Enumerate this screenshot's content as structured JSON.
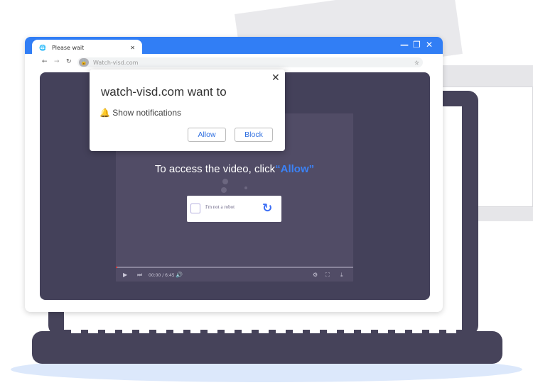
{
  "browser": {
    "tab_title": "Please wait",
    "url": "Watch-visd.com",
    "accent": "#317ef5"
  },
  "popup": {
    "title": "watch-visd.com want to",
    "permission": "Show notifications",
    "allow_label": "Allow",
    "block_label": "Block"
  },
  "video": {
    "headline_prefix": "To access the video, click",
    "headline_highlight": "“Allow”",
    "captcha_label": "I'm not a robot",
    "time": "00:00 / 6:45",
    "progress": 0
  }
}
